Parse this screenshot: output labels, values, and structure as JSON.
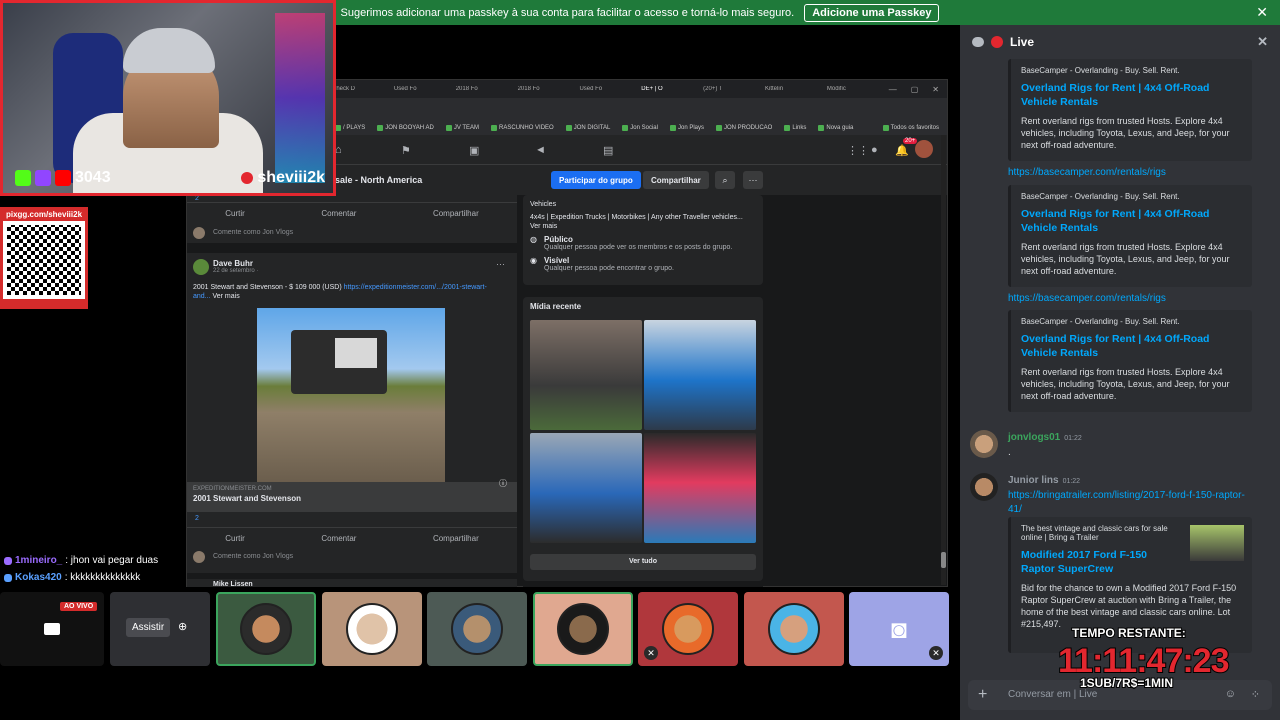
{
  "banner": {
    "text": "Sugerimos adicionar uma passkey à sua conta para facilitar o acesso e torná-lo mais seguro.",
    "button": "Adicione uma Passkey",
    "close": "✕"
  },
  "stream": {
    "viewers": "3043",
    "username": "sheviii2k",
    "qr_url": "pixgg.com/sheviii2k"
  },
  "overlay_chat": [
    {
      "name": "1mineiro_",
      "text": ": jhon vai pegar duas",
      "color": "#9b6cff"
    },
    {
      "name": "Kokas420",
      "text": ": kkkkkkkkkkkkkk",
      "color": "#5aa0ff"
    }
  ],
  "browser": {
    "tabs": [
      "Check D",
      "Used Fo",
      "2018 Fo",
      "2018 Fo",
      "Used Fo",
      "DE+ | O",
      "(20+) T",
      "Kittelin",
      "Modific"
    ],
    "bookmarks": [
      "/ PLAYS",
      "JON BOOYAH AD",
      "JV TEAM",
      "RASCUNHO VIDEO",
      "JON DIGITAL",
      "Jon Social",
      "Jon Plays",
      "JON PRODUCAO",
      "Links",
      "Nova guia",
      "Todos os favoritos"
    ],
    "group_title": "r sale - North America",
    "join_button": "Participar do grupo",
    "share_button": "Compartilhar",
    "notif_count": "20+"
  },
  "feed": {
    "actions": {
      "like": "Curtir",
      "comment": "Comentar",
      "share": "Compartilhar"
    },
    "comment_placeholder": "Comente como Jon Vlogs",
    "reaction_count": "2",
    "post": {
      "author": "Dave Buhr",
      "date": "22 de setembro · ",
      "text": "2001 Stewart and Stevenson - $ 109 000 (USD) ",
      "link": "https://expeditionmeister.com/.../2001-stewart-and...",
      "more": " Ver mais",
      "link_domain": "EXPEDITIONMEISTER.COM",
      "link_title": "2001 Stewart and Stevenson",
      "reaction_count": "2"
    },
    "next_author": "Mike Lissen"
  },
  "sidebar": {
    "vehicles_label": "Vehicles",
    "vehicles_text": "4x4s | Expedition Trucks | Motorbikes | Any other Traveller vehicles...",
    "ver_mais": "Ver mais",
    "public_title": "Público",
    "public_desc": "Qualquer pessoa pode ver os membros e os posts do grupo.",
    "visible_title": "Visível",
    "visible_desc": "Qualquer pessoa pode encontrar o grupo.",
    "media_title": "Mídia recente",
    "see_all": "Ver tudo"
  },
  "participants": {
    "live_tag": "AO VIVO",
    "watch_button": "Assistir"
  },
  "panel": {
    "title": "Live",
    "embeds": [
      {
        "provider": "BaseCamper - Overlanding - Buy. Sell. Rent.",
        "title": "Overland Rigs for Rent | 4x4 Off-Road Vehicle Rentals",
        "desc": "Rent overland rigs from trusted Hosts. Explore 4x4 vehicles, including Toyota, Lexus, and Jeep, for your next off-road adventure."
      },
      {
        "provider": "BaseCamper - Overlanding - Buy. Sell. Rent.",
        "title": "Overland Rigs for Rent | 4x4 Off-Road Vehicle Rentals",
        "desc": "Rent overland rigs from trusted Hosts. Explore 4x4 vehicles, including Toyota, Lexus, and Jeep, for your next off-road adventure."
      },
      {
        "provider": "BaseCamper - Overlanding - Buy. Sell. Rent.",
        "title": "Overland Rigs for Rent | 4x4 Off-Road Vehicle Rentals",
        "desc": "Rent overland rigs from trusted Hosts. Explore 4x4 vehicles, including Toyota, Lexus, and Jeep, for your next off-road adventure."
      }
    ],
    "links": [
      "https://basecamper.com/rentals/rigs",
      "https://basecamper.com/rentals/rigs"
    ],
    "messages": [
      {
        "user": "jonvlogs01",
        "time": "01:22",
        "body": ".",
        "color": "#3ba55d"
      },
      {
        "user": "Junior lins",
        "time": "01:22",
        "body": "https://bringatrailer.com/listing/2017-ford-f-150-raptor-41/",
        "color": "#949ba4"
      }
    ],
    "bat_embed": {
      "provider": "The best vintage and classic cars for sale online | Bring a Trailer",
      "title": "Modified 2017 Ford F-150 Raptor SuperCrew",
      "desc": "Bid for the chance to own a Modified 2017 Ford F-150 Raptor SuperCrew at auction with Bring a Trailer, the home of the best vintage and classic cars online. Lot #215,497."
    },
    "compose_placeholder": "Conversar em  | Live"
  },
  "timer": {
    "label": "TEMPO RESTANTE:",
    "value": "11:11:47:23",
    "sub": "1SUB/7R$=1MIN"
  },
  "colors": {
    "accent_red": "#e3272f",
    "discord_link": "#00a8fc",
    "fb_blue": "#1b6ef2",
    "banner_green": "#1f7a3a"
  }
}
